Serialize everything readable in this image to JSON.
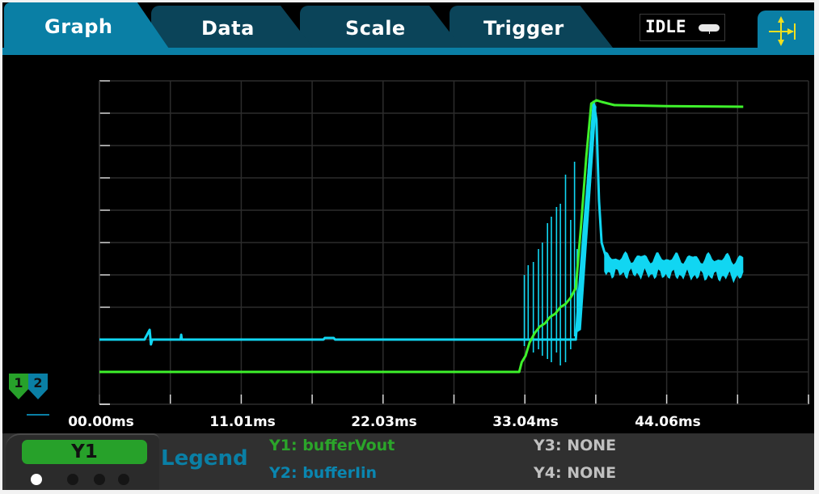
{
  "tabs": [
    {
      "label": "Graph",
      "active": true
    },
    {
      "label": "Data",
      "active": false
    },
    {
      "label": "Scale",
      "active": false
    },
    {
      "label": "Trigger",
      "active": false
    }
  ],
  "status": {
    "text": "IDLE",
    "icon": "pill-indicator-icon"
  },
  "pan_button": {
    "icon": "pan-zoom-arrows-icon"
  },
  "colors": {
    "accent": "#0a7fa5",
    "tab_inactive": "#0b4459",
    "trace_y1": "#3ef12b",
    "trace_y2": "#11d6f2",
    "y1_button": "#27a12a",
    "legend_y1": "#2ba52a",
    "legend_y2": "#0a86b0",
    "legend_none": "#c0c0c0",
    "icon_yellow": "#f0e020"
  },
  "graph_markers": [
    {
      "label": "1",
      "color": "#27a12a"
    },
    {
      "label": "2",
      "color": "#0a7fa5"
    }
  ],
  "chart_data": {
    "type": "line",
    "title": "",
    "xlabel": "",
    "ylabel": "",
    "x_unit": "ms",
    "xlim": [
      0,
      55.07
    ],
    "x_tick_labels": [
      "00.00ms",
      "11.01ms",
      "22.03ms",
      "33.04ms",
      "44.06ms"
    ],
    "x_tick_values": [
      0,
      11.01,
      22.03,
      33.04,
      44.06
    ],
    "grid": true,
    "grid_divisions": {
      "x": 10,
      "y": 10
    },
    "ylim_divisions": [
      0,
      10
    ],
    "series": [
      {
        "name": "Y1: bufferVout",
        "axis": "Y1",
        "color": "#3ef12b",
        "points": [
          [
            0,
            1.0
          ],
          [
            32.6,
            1.0
          ],
          [
            32.8,
            1.3
          ],
          [
            33.1,
            1.5
          ],
          [
            33.4,
            1.9
          ],
          [
            33.8,
            2.2
          ],
          [
            34.2,
            2.4
          ],
          [
            34.6,
            2.5
          ],
          [
            35.0,
            2.7
          ],
          [
            35.4,
            2.8
          ],
          [
            35.8,
            3.0
          ],
          [
            36.2,
            3.1
          ],
          [
            36.6,
            3.3
          ],
          [
            37.0,
            3.6
          ],
          [
            37.4,
            5.5
          ],
          [
            37.8,
            7.6
          ],
          [
            38.2,
            9.3
          ],
          [
            38.6,
            9.4
          ],
          [
            39.0,
            9.35
          ],
          [
            40.0,
            9.25
          ],
          [
            44.0,
            9.22
          ],
          [
            50.0,
            9.2
          ]
        ]
      },
      {
        "name": "Y2: bufferIin",
        "axis": "Y2",
        "color": "#11d6f2",
        "points": [
          [
            0,
            2.0
          ],
          [
            3.5,
            2.0
          ],
          [
            3.9,
            2.3
          ],
          [
            4.0,
            1.85
          ],
          [
            4.1,
            2.0
          ],
          [
            6.3,
            2.0
          ],
          [
            6.35,
            2.15
          ],
          [
            6.4,
            2.0
          ],
          [
            17.4,
            2.0
          ],
          [
            17.5,
            2.05
          ],
          [
            18.2,
            2.05
          ],
          [
            18.3,
            2.0
          ],
          [
            32.8,
            2.0
          ],
          [
            37.0,
            2.0
          ],
          [
            37.2,
            3.2
          ],
          [
            37.6,
            5.3
          ],
          [
            38.0,
            7.2
          ],
          [
            38.4,
            9.3
          ],
          [
            38.6,
            8.8
          ],
          [
            38.8,
            6.3
          ],
          [
            39.0,
            5.0
          ],
          [
            39.3,
            4.6
          ],
          [
            40.0,
            4.3
          ],
          [
            45.0,
            4.3
          ],
          [
            50.0,
            4.1
          ]
        ]
      }
    ]
  },
  "x_axis_labels": [
    "00.00ms",
    "11.01ms",
    "22.03ms",
    "33.04ms",
    "44.06ms"
  ],
  "bottom_panel": {
    "selected_axis": "Y1",
    "page_dots": 4,
    "active_dot": 0,
    "legend_label": "Legend",
    "legend": [
      {
        "text": "Y1: bufferVout"
      },
      {
        "text": "Y2: bufferIin"
      },
      {
        "text": "Y3: NONE"
      },
      {
        "text": "Y4: NONE"
      }
    ]
  }
}
